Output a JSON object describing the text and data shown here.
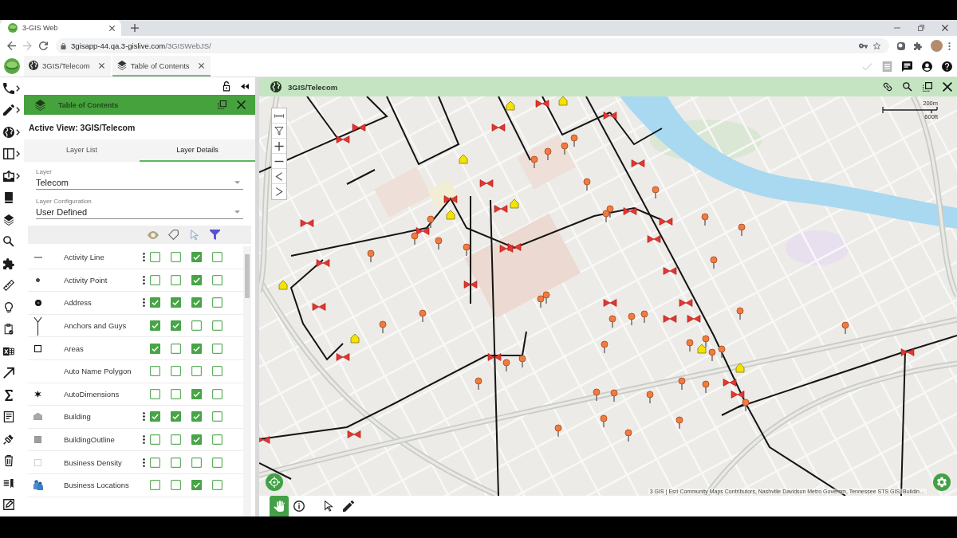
{
  "browser": {
    "tab_title": "3-GIS Web",
    "url_host": "3gisapp-44.qa.3-gislive.com",
    "url_path": "/3GISWebJS/"
  },
  "app_header": {
    "tabs": [
      {
        "label": "3GIS/Telecom",
        "selected": false
      },
      {
        "label": "Table of Contents",
        "selected": true
      }
    ],
    "actions": [
      {
        "kind": "check",
        "disabled": true
      },
      {
        "kind": "list",
        "disabled": true
      },
      {
        "kind": "chat",
        "disabled": false
      },
      {
        "kind": "account",
        "disabled": false
      },
      {
        "kind": "help",
        "disabled": false
      }
    ]
  },
  "sidebar": {
    "items": [
      {
        "kind": "phone",
        "has_submenu": true
      },
      {
        "kind": "pencil",
        "has_submenu": true
      },
      {
        "kind": "globe",
        "has_submenu": true
      },
      {
        "kind": "panel",
        "has_submenu": true
      },
      {
        "kind": "tray-upload",
        "has_submenu": true
      },
      {
        "kind": "book",
        "has_submenu": false
      },
      {
        "kind": "layers",
        "has_submenu": false
      },
      {
        "kind": "search",
        "has_submenu": false
      },
      {
        "kind": "puzzle",
        "has_submenu": false
      },
      {
        "kind": "ruler",
        "has_submenu": false
      },
      {
        "kind": "lightbulb",
        "has_submenu": false
      },
      {
        "kind": "clipboard",
        "has_submenu": false
      },
      {
        "kind": "spreadsheet",
        "has_submenu": false
      },
      {
        "kind": "arrow",
        "has_submenu": false
      },
      {
        "kind": "sigma",
        "has_submenu": false
      },
      {
        "kind": "document",
        "has_submenu": false
      },
      {
        "kind": "plug",
        "has_submenu": false
      },
      {
        "kind": "bin",
        "has_submenu": false
      },
      {
        "kind": "list-pencil",
        "has_submenu": false
      },
      {
        "kind": "form-edit",
        "has_submenu": false
      }
    ]
  },
  "toc_panel": {
    "title": "Table of Contents",
    "active_view": "Active View: 3GIS/Telecom",
    "tabs": [
      {
        "label": "Layer List",
        "selected": false
      },
      {
        "label": "Layer Details",
        "selected": true
      }
    ],
    "fields": [
      {
        "label": "Layer",
        "value": "Telecom"
      },
      {
        "label": "Layer Configuration",
        "value": "User Defined"
      }
    ],
    "layers": [
      {
        "name": "Activity Line",
        "kind": "line",
        "has_menu": true,
        "checkboxes": [
          {
            "checked": false
          },
          {
            "checked": false
          },
          {
            "checked": true
          },
          {
            "checked": false
          }
        ]
      },
      {
        "name": "Activity Point",
        "kind": "dot",
        "has_menu": true,
        "checkboxes": [
          {
            "checked": false
          },
          {
            "checked": false
          },
          {
            "checked": true
          },
          {
            "checked": false
          }
        ]
      },
      {
        "name": "Address",
        "kind": "circle",
        "has_menu": true,
        "checkboxes": [
          {
            "checked": true
          },
          {
            "checked": true
          },
          {
            "checked": true
          },
          {
            "checked": false
          }
        ]
      },
      {
        "name": "Anchors and Guys",
        "kind": "y-shape",
        "has_menu": false,
        "checkboxes": [
          {
            "checked": true
          },
          {
            "checked": true
          },
          {
            "checked": false
          },
          {
            "checked": false
          }
        ]
      },
      {
        "name": "Areas",
        "kind": "square-outline",
        "has_menu": false,
        "checkboxes": [
          {
            "checked": true
          },
          {
            "checked": false
          },
          {
            "checked": true
          },
          {
            "checked": false
          }
        ]
      },
      {
        "name": "Auto Name Polygon",
        "kind": "none",
        "has_menu": false,
        "checkboxes": [
          {
            "checked": false
          },
          {
            "checked": false
          },
          {
            "checked": false
          },
          {
            "checked": false
          }
        ]
      },
      {
        "name": "AutoDimensions",
        "kind": "asterisk",
        "has_menu": false,
        "checkboxes": [
          {
            "checked": false
          },
          {
            "checked": false
          },
          {
            "checked": true
          },
          {
            "checked": false
          }
        ]
      },
      {
        "name": "Building",
        "kind": "house",
        "has_menu": true,
        "checkboxes": [
          {
            "checked": true
          },
          {
            "checked": true
          },
          {
            "checked": true
          },
          {
            "checked": false
          }
        ]
      },
      {
        "name": "BuildingOutline",
        "kind": "square-grey",
        "has_menu": true,
        "checkboxes": [
          {
            "checked": false
          },
          {
            "checked": false
          },
          {
            "checked": true
          },
          {
            "checked": false
          }
        ]
      },
      {
        "name": "Business Density",
        "kind": "square-light",
        "has_menu": true,
        "checkboxes": [
          {
            "checked": false
          },
          {
            "checked": false
          },
          {
            "checked": false
          },
          {
            "checked": false
          }
        ]
      },
      {
        "name": "Business Locations",
        "kind": "people",
        "has_menu": false,
        "checkboxes": [
          {
            "checked": false
          },
          {
            "checked": false
          },
          {
            "checked": true
          },
          {
            "checked": false
          }
        ]
      }
    ]
  },
  "map_panel": {
    "title": "3GIS/Telecom",
    "navigation": [
      {
        "kind": "measure"
      },
      {
        "kind": "filter"
      },
      {
        "kind": "zoom-in"
      },
      {
        "kind": "zoom-out"
      },
      {
        "kind": "previous"
      },
      {
        "kind": "next"
      }
    ],
    "scale_bar": {
      "top_label": "200m",
      "bottom_label": "600ft"
    },
    "attribution": "3 GIS | Esri Community Maps Contributors, Nashville Davidson Metro Governm, Tennessee STS GIS, Buildin…",
    "tools": [
      {
        "kind": "pan",
        "selected": true
      },
      {
        "kind": "info",
        "selected": false
      },
      {
        "kind": "select",
        "selected": false
      },
      {
        "kind": "edit",
        "selected": false
      }
    ]
  }
}
